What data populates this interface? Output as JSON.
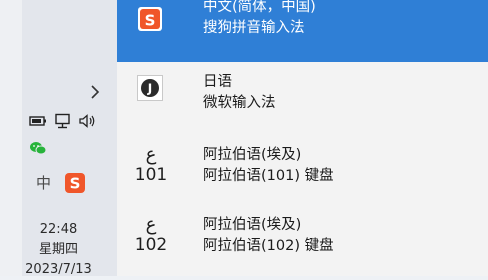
{
  "taskbar": {
    "ime_indicator": "中",
    "time": "22:48",
    "weekday": "星期四",
    "date": "2023/7/13",
    "colors": {
      "sogou": "#f0562a",
      "wechat": "#27b33b"
    }
  },
  "ime_list": [
    {
      "title": "中文(简体，中国)",
      "subtitle": "搜狗拼音输入法",
      "icon": "sogou-icon",
      "selected": true
    },
    {
      "title": "日语",
      "subtitle": "微软输入法",
      "icon": "ime-j-icon",
      "selected": false
    },
    {
      "title": "阿拉伯语(埃及)",
      "subtitle": "阿拉伯语(101) 键盘",
      "icon_glyph": "ع",
      "icon_number": "101",
      "selected": false
    },
    {
      "title": "阿拉伯语(埃及)",
      "subtitle": "阿拉伯语(102) 键盘",
      "icon_glyph": "ع",
      "icon_number": "102",
      "selected": false
    }
  ],
  "colors": {
    "selected_bg": "#2f7fd6"
  }
}
